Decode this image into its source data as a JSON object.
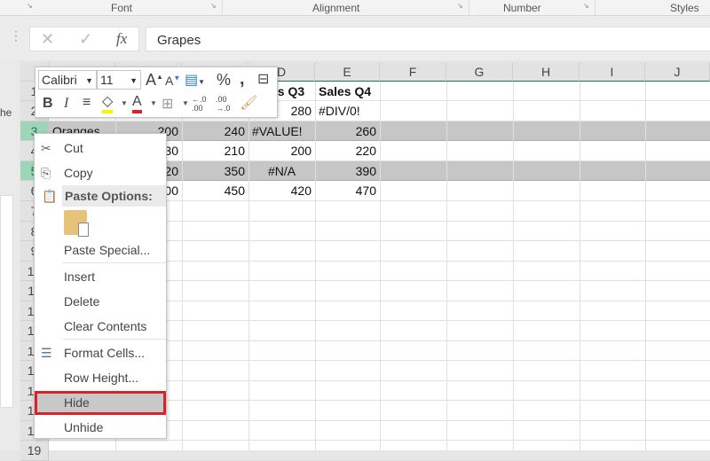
{
  "ribbon": {
    "groups": [
      "Font",
      "Alignment",
      "Number",
      "Styles"
    ]
  },
  "formula_bar": {
    "cancel_icon": "✕",
    "enter_icon": "✓",
    "fx_label": "fx",
    "value": "Grapes"
  },
  "left_pane": {
    "text": "he"
  },
  "columns": [
    "D",
    "E",
    "F",
    "G",
    "H",
    "I",
    "J"
  ],
  "rows": [
    "1",
    "2",
    "3",
    "4",
    "5",
    "6",
    "7",
    "8",
    "9",
    "10",
    "11",
    "12",
    "13",
    "14",
    "15",
    "16",
    "17",
    "18",
    "19"
  ],
  "cells": {
    "r1": {
      "D": "Sales Q3",
      "E": "Sales Q4"
    },
    "r2": {
      "D": "280",
      "E": "#DIV/0!"
    },
    "r3": {
      "A": "Oranges",
      "B": "200",
      "C": "240",
      "D": "#VALUE!",
      "E": "260"
    },
    "r4": {
      "B": "30",
      "C": "210",
      "D": "200",
      "E": "220"
    },
    "r5": {
      "B": "20",
      "C": "350",
      "D": "#N/A",
      "E": "390"
    },
    "r6": {
      "B": "00",
      "C": "450",
      "D": "420",
      "E": "470"
    }
  },
  "mini_toolbar": {
    "font": "Calibri",
    "size": "11",
    "bold": "B",
    "italic": "I",
    "percent": "%",
    "comma": ","
  },
  "context_menu": {
    "cut": "Cut",
    "copy": "Copy",
    "paste_options": "Paste Options:",
    "paste_special": "Paste Special...",
    "insert": "Insert",
    "delete": "Delete",
    "clear_contents": "Clear Contents",
    "format_cells": "Format Cells...",
    "row_height": "Row Height...",
    "hide": "Hide",
    "unhide": "Unhide"
  },
  "colors": {
    "accent": "#217346",
    "highlight": "#d9222a"
  }
}
